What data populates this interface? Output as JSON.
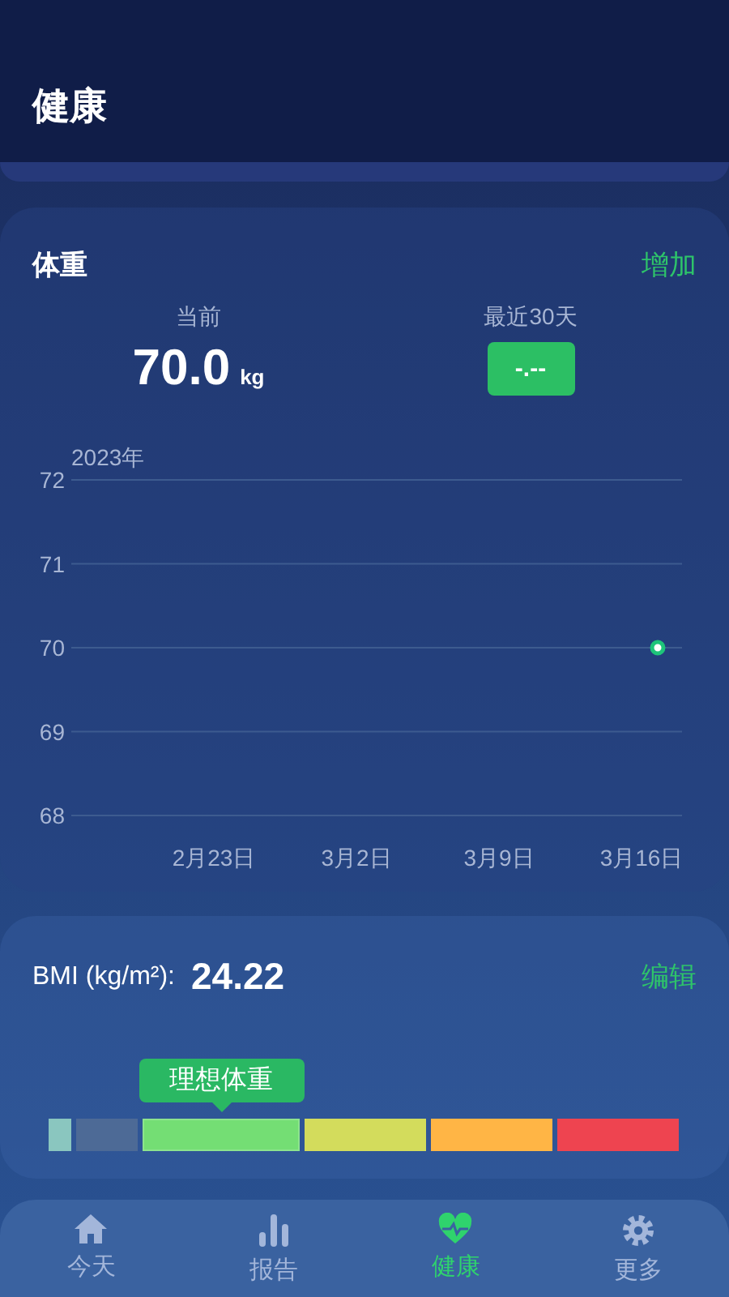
{
  "header": {
    "title": "健康"
  },
  "weight": {
    "title": "体重",
    "add_link": "增加",
    "current": {
      "label": "当前",
      "value": "70.0",
      "unit": "kg"
    },
    "recent": {
      "label": "最近30天",
      "value": "-.--"
    },
    "chart_data": {
      "type": "scatter",
      "title": "2023年",
      "categories": [
        "2月23日",
        "3月2日",
        "3月9日",
        "3月16日"
      ],
      "series": [
        {
          "color": "#1ec47a",
          "values": [
            null,
            null,
            null,
            70
          ]
        }
      ],
      "ylim": [
        68,
        72
      ],
      "grid": true,
      "yticks": [
        68,
        69,
        70,
        71,
        72
      ]
    }
  },
  "bmi": {
    "label": "BMI (kg/m²):",
    "value": "24.22",
    "edit_link": "编辑",
    "indicator": "理想体重",
    "segments": [
      {
        "color": "#8ac6bf",
        "selected": false
      },
      {
        "color": "#4d6a96",
        "selected": false
      },
      {
        "color": "#74de74",
        "selected": true
      },
      {
        "color": "#d3dc5c",
        "selected": false
      },
      {
        "color": "#ffb545",
        "selected": false
      },
      {
        "color": "#ee4450",
        "selected": false
      }
    ]
  },
  "nav": [
    {
      "label": "今天",
      "selected": false
    },
    {
      "label": "报告",
      "selected": false
    },
    {
      "label": "健康",
      "selected": true
    },
    {
      "label": "更多",
      "selected": false
    }
  ]
}
